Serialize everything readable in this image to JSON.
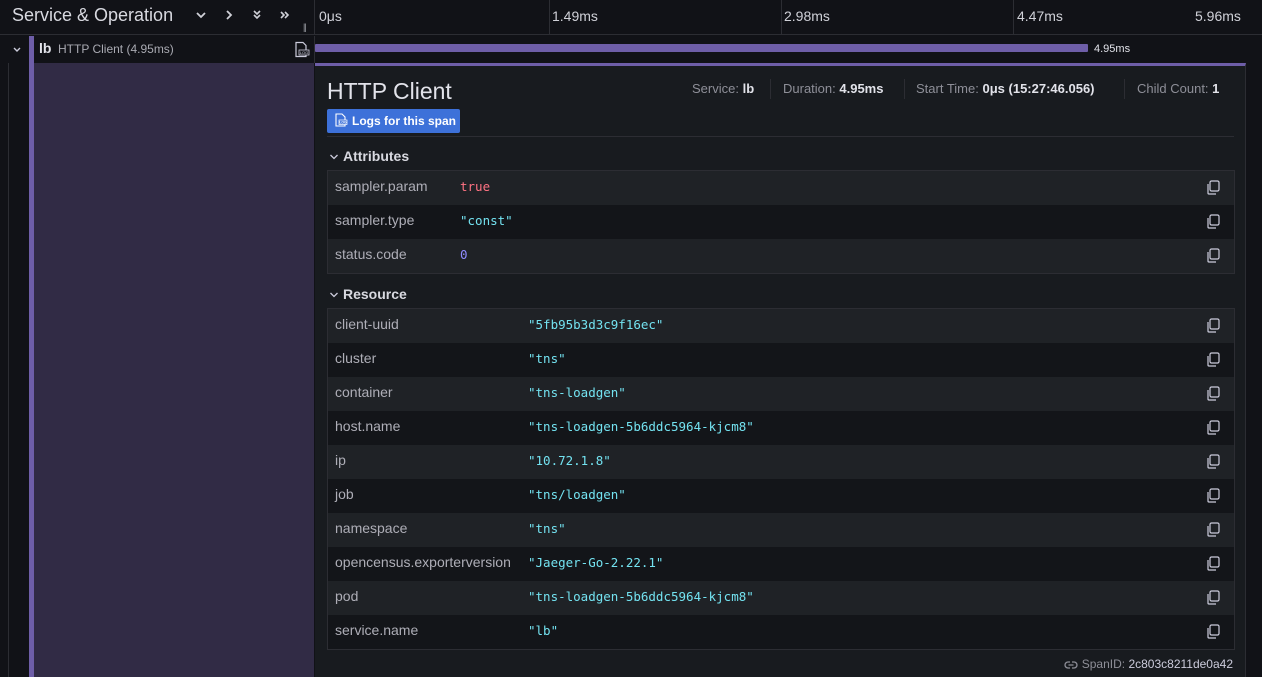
{
  "header": {
    "title": "Service & Operation",
    "ticks": [
      "0μs",
      "1.49ms",
      "2.98ms",
      "4.47ms",
      "5.96ms"
    ]
  },
  "span": {
    "service": "lb",
    "operation": "HTTP Client (4.95ms)",
    "bar_label": "4.95ms",
    "duration_fraction": 0.83
  },
  "detail": {
    "title": "HTTP Client",
    "logs_button": "Logs for this span",
    "meta": [
      {
        "label": "Service:",
        "value": "lb"
      },
      {
        "label": "Duration:",
        "value": "4.95ms"
      },
      {
        "label": "Start Time:",
        "value": "0μs (15:27:46.056)"
      },
      {
        "label": "Child Count:",
        "value": "1"
      }
    ],
    "attributes_title": "Attributes",
    "attributes": [
      {
        "key": "sampler.param",
        "value": "true",
        "kind": "bool"
      },
      {
        "key": "sampler.type",
        "value": "\"const\"",
        "kind": "str"
      },
      {
        "key": "status.code",
        "value": "0",
        "kind": "num"
      }
    ],
    "resource_title": "Resource",
    "resource": [
      {
        "key": "client-uuid",
        "value": "\"5fb95b3d3c9f16ec\"",
        "kind": "str"
      },
      {
        "key": "cluster",
        "value": "\"tns\"",
        "kind": "str"
      },
      {
        "key": "container",
        "value": "\"tns-loadgen\"",
        "kind": "str"
      },
      {
        "key": "host.name",
        "value": "\"tns-loadgen-5b6ddc5964-kjcm8\"",
        "kind": "str"
      },
      {
        "key": "ip",
        "value": "\"10.72.1.8\"",
        "kind": "str"
      },
      {
        "key": "job",
        "value": "\"tns/loadgen\"",
        "kind": "str"
      },
      {
        "key": "namespace",
        "value": "\"tns\"",
        "kind": "str"
      },
      {
        "key": "opencensus.exporterversion",
        "value": "\"Jaeger-Go-2.22.1\"",
        "kind": "str"
      },
      {
        "key": "pod",
        "value": "\"tns-loadgen-5b6ddc5964-kjcm8\"",
        "kind": "str"
      },
      {
        "key": "service.name",
        "value": "\"lb\"",
        "kind": "str"
      }
    ],
    "span_id_label": "SpanID:",
    "span_id": "2c803c8211de0a42"
  },
  "colors": {
    "span_accent": "#6e5ea8",
    "button_blue": "#3d71d9",
    "string_value": "#73e2f0",
    "bool_value": "#ff7383",
    "number_value": "#8f8bff"
  }
}
